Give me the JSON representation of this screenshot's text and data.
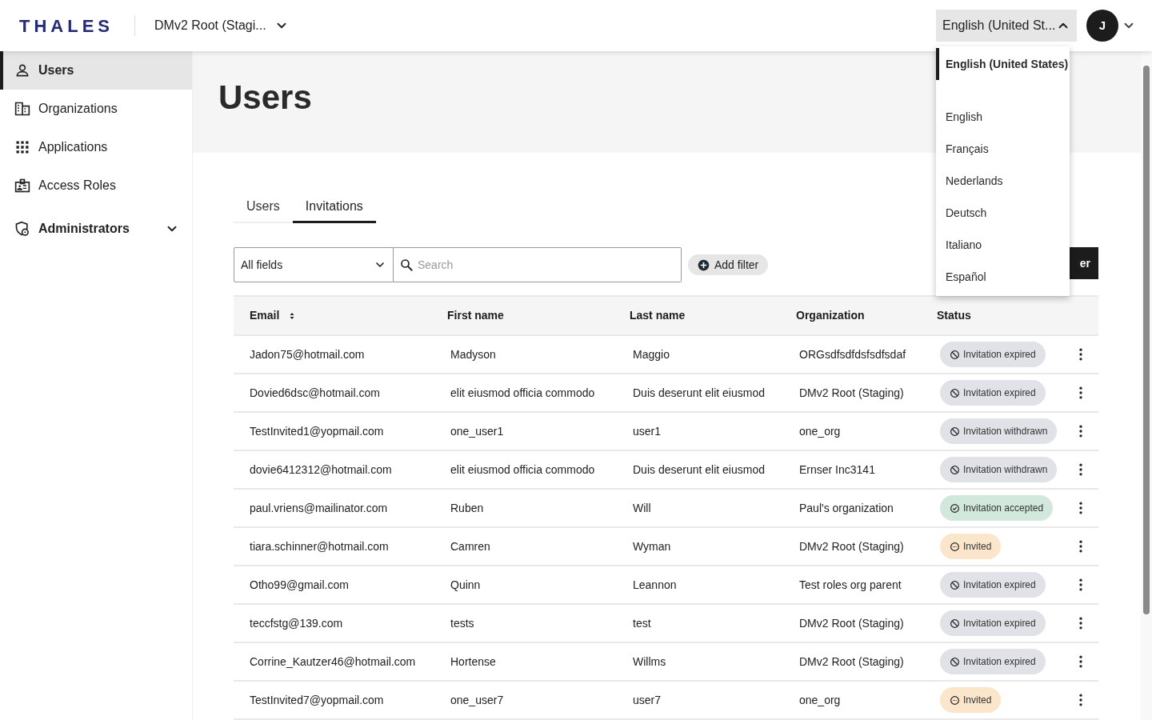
{
  "header": {
    "logo": "THALES",
    "tenant": "DMv2 Root (Stagi...",
    "language": {
      "label": "English (United St...",
      "expanded": true
    },
    "avatar": "J"
  },
  "language_menu": [
    {
      "label": "English (United States)",
      "selected": true
    },
    {
      "label": "English",
      "selected": false
    },
    {
      "label": "Français",
      "selected": false
    },
    {
      "label": "Nederlands",
      "selected": false
    },
    {
      "label": "Deutsch",
      "selected": false
    },
    {
      "label": "Italiano",
      "selected": false
    },
    {
      "label": "Español",
      "selected": false
    }
  ],
  "sidebar": {
    "items": [
      {
        "label": "Users",
        "selected": true,
        "kind": "link"
      },
      {
        "label": "Organizations",
        "selected": false,
        "kind": "link"
      },
      {
        "label": "Applications",
        "selected": false,
        "kind": "link"
      },
      {
        "label": "Access Roles",
        "selected": false,
        "kind": "link"
      },
      {
        "label": "Administrators",
        "selected": false,
        "kind": "group",
        "expanded": false
      }
    ]
  },
  "page_title": "Users",
  "tabs": [
    {
      "label": "Users",
      "selected": false
    },
    {
      "label": "Invitations",
      "selected": true
    }
  ],
  "toolbar": {
    "field_select": "All fields",
    "search": {
      "placeholder": "Search"
    },
    "add_filter": "Add filter",
    "primary_button": "er"
  },
  "table": {
    "columns": [
      "Email",
      "First name",
      "Last name",
      "Organization",
      "Status"
    ],
    "rows": [
      {
        "email": "Jadon75@hotmail.com",
        "first_name": "Madyson",
        "last_name": "Maggio",
        "organization": "ORGsdfsdfdsfsdfsdaf",
        "status": "Invitation expired",
        "kind": "expired"
      },
      {
        "email": "Dovied6dsc@hotmail.com",
        "first_name": "elit eiusmod officia commodo",
        "last_name": "Duis deserunt elit eiusmod",
        "organization": "DMv2 Root (Staging)",
        "status": "Invitation expired",
        "kind": "expired"
      },
      {
        "email": "TestInvited1@yopmail.com",
        "first_name": "one_user1",
        "last_name": "user1",
        "organization": "one_org",
        "status": "Invitation withdrawn",
        "kind": "withdrawn"
      },
      {
        "email": "dovie6412312@hotmail.com",
        "first_name": "elit eiusmod officia commodo",
        "last_name": "Duis deserunt elit eiusmod",
        "organization": "Ernser Inc3141",
        "status": "Invitation withdrawn",
        "kind": "withdrawn"
      },
      {
        "email": "paul.vriens@mailinator.com",
        "first_name": "Ruben",
        "last_name": "Will",
        "organization": "Paul's organization",
        "status": "Invitation accepted",
        "kind": "accepted"
      },
      {
        "email": "tiara.schinner@hotmail.com",
        "first_name": "Camren",
        "last_name": "Wyman",
        "organization": "DMv2 Root (Staging)",
        "status": "Invited",
        "kind": "invited"
      },
      {
        "email": "Otho99@gmail.com",
        "first_name": "Quinn",
        "last_name": "Leannon",
        "organization": "Test roles org parent",
        "status": "Invitation expired",
        "kind": "expired"
      },
      {
        "email": "teccfstg@139.com",
        "first_name": "tests",
        "last_name": "test",
        "organization": "DMv2 Root (Staging)",
        "status": "Invitation expired",
        "kind": "expired"
      },
      {
        "email": "Corrine_Kautzer46@hotmail.com",
        "first_name": "Hortense",
        "last_name": "Willms",
        "organization": "DMv2 Root (Staging)",
        "status": "Invitation expired",
        "kind": "expired"
      },
      {
        "email": "TestInvited7@yopmail.com",
        "first_name": "one_user7",
        "last_name": "user7",
        "organization": "one_org",
        "status": "Invited",
        "kind": "invited"
      }
    ]
  }
}
